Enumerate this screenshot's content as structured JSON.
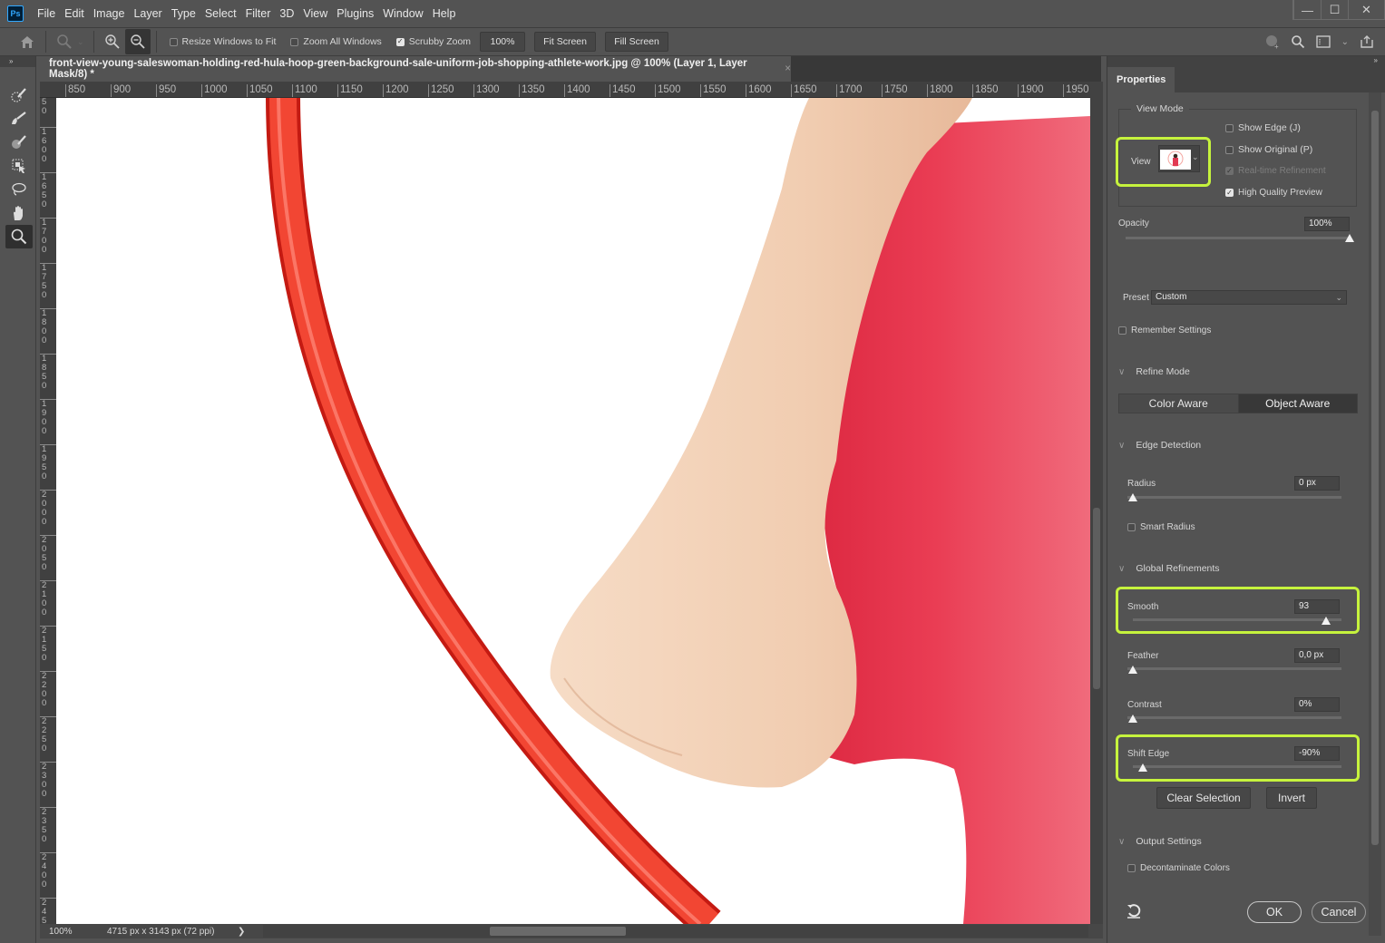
{
  "app": {
    "name": "Photoshop",
    "logo": "Ps"
  },
  "menu": [
    "File",
    "Edit",
    "Image",
    "Layer",
    "Type",
    "Select",
    "Filter",
    "3D",
    "View",
    "Plugins",
    "Window",
    "Help"
  ],
  "window_controls": {
    "minimize": "—",
    "maximize": "☐",
    "close": "✕"
  },
  "options_bar": {
    "resize_windows": {
      "label": "Resize Windows to Fit",
      "checked": false
    },
    "zoom_all": {
      "label": "Zoom All Windows",
      "checked": false
    },
    "scrubby_zoom": {
      "label": "Scrubby Zoom",
      "checked": true
    },
    "zoom_value": "100%",
    "fit_screen": "Fit Screen",
    "fill_screen": "Fill Screen"
  },
  "tools": [
    "quick-selection-brush",
    "refine-edge-brush",
    "brush",
    "object-selection",
    "lasso",
    "hand",
    "zoom"
  ],
  "document": {
    "tab_title": "front-view-young-saleswoman-holding-red-hula-hoop-green-background-sale-uniform-job-shopping-athlete-work.jpg @ 100% (Layer 1, Layer Mask/8) *",
    "close": "×"
  },
  "ruler_h": [
    "850",
    "900",
    "950",
    "1000",
    "1050",
    "1100",
    "1150",
    "1200",
    "1250",
    "1300",
    "1350",
    "1400",
    "1450",
    "1500",
    "1550",
    "1600",
    "1650",
    "1700",
    "1750",
    "1800",
    "1850",
    "1900",
    "1950"
  ],
  "ruler_v": [
    "50",
    "1600",
    "1650",
    "1700",
    "1750",
    "1800",
    "1850",
    "1900",
    "1950",
    "2000",
    "2050",
    "2100",
    "2150",
    "2200",
    "2250",
    "2300",
    "2350",
    "2400",
    "245"
  ],
  "status": {
    "zoom": "100%",
    "info": "4715 px x 3143 px (72 ppi)",
    "arrow": "❯"
  },
  "panel": {
    "tab": "Properties",
    "view_mode": {
      "title": "View Mode",
      "view_label": "View",
      "show_edge": {
        "label": "Show Edge (J)",
        "checked": false
      },
      "show_original": {
        "label": "Show Original (P)",
        "checked": false
      },
      "realtime": {
        "label": "Real-time Refinement",
        "checked": true,
        "disabled": true
      },
      "hq_preview": {
        "label": "High Quality Preview",
        "checked": true
      }
    },
    "opacity": {
      "label": "Opacity",
      "value": "100%",
      "fraction": 1.0
    },
    "preset": {
      "label": "Preset",
      "value": "Custom"
    },
    "remember": {
      "label": "Remember Settings",
      "checked": false
    },
    "refine_mode": {
      "title": "Refine Mode",
      "options": [
        "Color Aware",
        "Object Aware"
      ],
      "selected": "Object Aware"
    },
    "edge_detection": {
      "title": "Edge Detection",
      "radius": {
        "label": "Radius",
        "value": "0 px",
        "fraction": 0
      },
      "smart_radius": {
        "label": "Smart Radius",
        "checked": false
      }
    },
    "global_refinements": {
      "title": "Global Refinements",
      "smooth": {
        "label": "Smooth",
        "value": "93",
        "fraction": 0.93
      },
      "feather": {
        "label": "Feather",
        "value": "0,0 px",
        "fraction": 0
      },
      "contrast": {
        "label": "Contrast",
        "value": "0%",
        "fraction": 0
      },
      "shift_edge": {
        "label": "Shift Edge",
        "value": "-90%",
        "fraction": 0.05
      }
    },
    "clear_selection": "Clear Selection",
    "invert": "Invert",
    "output_settings": {
      "title": "Output Settings",
      "decontaminate": {
        "label": "Decontaminate Colors",
        "checked": false
      }
    },
    "ok": "OK",
    "cancel": "Cancel"
  },
  "colors": {
    "highlight": "#c6f33d",
    "hoop": "#ee3a2f",
    "shirt": "#e8384e",
    "skin": "#f3d2b8"
  }
}
